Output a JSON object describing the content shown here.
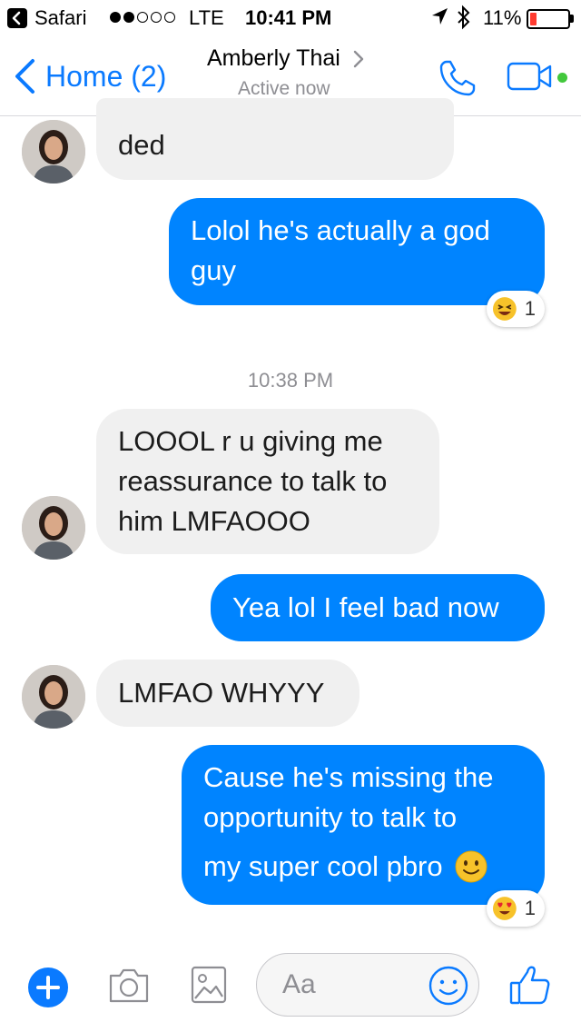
{
  "status_bar": {
    "back_app": "Safari",
    "carrier": "LTE",
    "time": "10:41 PM",
    "battery": "11%",
    "signal_bars_filled": 2,
    "signal_bars_total": 5
  },
  "nav": {
    "back_label": "Home (2)",
    "contact_name": "Amberly Thai",
    "contact_status": "Active now",
    "accent_color": "#0a7aff",
    "active_dot_color": "#42c83c"
  },
  "messages": {
    "m1": {
      "line1": "ded"
    },
    "m2": {
      "line1": "Lolol he's actually a god",
      "line2": "guy",
      "reaction_emoji": "grinning-squinting-face",
      "reaction_count": "1"
    },
    "timestamp": "10:38 PM",
    "m3": {
      "line1": "LOOOL r u giving me",
      "line2": "reassurance to talk to",
      "line3": "him LMFAOOO"
    },
    "m4": {
      "line1": "Yea lol I feel bad now"
    },
    "m5": {
      "line1": "LMFAO WHYYY"
    },
    "m6": {
      "line1": "Cause he's missing the",
      "line2": "opportunity to talk to",
      "line3": "my super cool pbro",
      "inline_emoji": "slightly-smiling-face",
      "reaction_emoji": "heart-eyes-face",
      "reaction_count": "1"
    }
  },
  "composer": {
    "placeholder": "Aa"
  },
  "colors": {
    "outgoing_bubble": "#0084ff",
    "incoming_bubble": "#f0f0f0",
    "battery_low": "#ff3b30"
  }
}
